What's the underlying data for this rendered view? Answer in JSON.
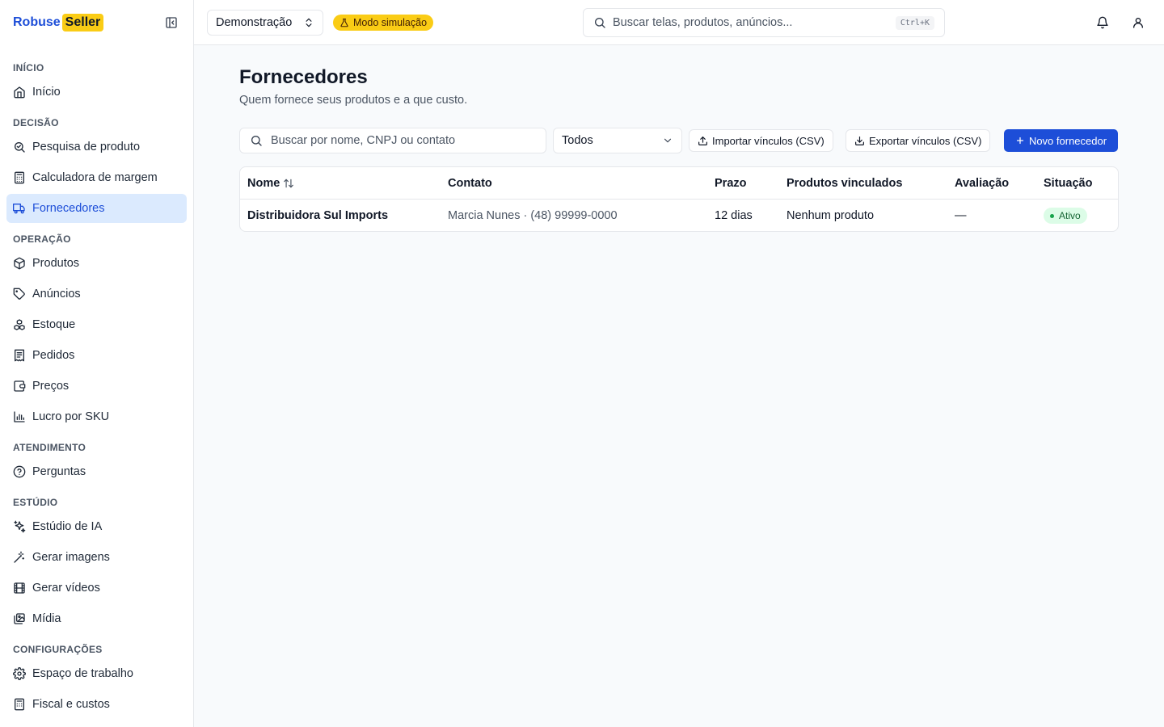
{
  "brand": {
    "word1": "Robuse",
    "word2": "Seller"
  },
  "sidebar": {
    "sections": [
      {
        "label": "INÍCIO",
        "items": [
          {
            "label": "Início",
            "icon": "home-icon"
          }
        ]
      },
      {
        "label": "DECISÃO",
        "items": [
          {
            "label": "Pesquisa de produto",
            "icon": "search-check-icon"
          },
          {
            "label": "Calculadora de margem",
            "icon": "calculator-icon"
          },
          {
            "label": "Fornecedores",
            "icon": "truck-icon",
            "active": true
          }
        ]
      },
      {
        "label": "OPERAÇÃO",
        "items": [
          {
            "label": "Produtos",
            "icon": "package-icon"
          },
          {
            "label": "Anúncios",
            "icon": "tag-icon"
          },
          {
            "label": "Estoque",
            "icon": "boxes-icon"
          },
          {
            "label": "Pedidos",
            "icon": "receipt-icon"
          },
          {
            "label": "Preços",
            "icon": "wallet-icon"
          },
          {
            "label": "Lucro por SKU",
            "icon": "bar-chart-icon"
          }
        ]
      },
      {
        "label": "ATENDIMENTO",
        "items": [
          {
            "label": "Perguntas",
            "icon": "help-circle-icon"
          }
        ]
      },
      {
        "label": "ESTÚDIO",
        "items": [
          {
            "label": "Estúdio de IA",
            "icon": "sparkles-icon"
          },
          {
            "label": "Gerar imagens",
            "icon": "wand-icon"
          },
          {
            "label": "Gerar vídeos",
            "icon": "film-icon"
          },
          {
            "label": "Mídia",
            "icon": "images-icon"
          }
        ]
      },
      {
        "label": "CONFIGURAÇÕES",
        "items": [
          {
            "label": "Espaço de trabalho",
            "icon": "gear-icon"
          },
          {
            "label": "Fiscal e custos",
            "icon": "calculator-icon"
          }
        ]
      }
    ]
  },
  "header": {
    "workspace": "Demonstração",
    "simulation_badge": "Modo simulação",
    "search_placeholder": "Buscar telas, produtos, anúncios...",
    "search_shortcut": "Ctrl+K"
  },
  "page": {
    "title": "Fornecedores",
    "subtitle": "Quem fornece seus produtos e a que custo."
  },
  "toolbar": {
    "search_placeholder": "Buscar por nome, CNPJ ou contato",
    "status_filter": "Todos",
    "import_label": "Importar vínculos (CSV)",
    "export_label": "Exportar vínculos (CSV)",
    "new_label": "Novo fornecedor"
  },
  "table": {
    "headers": {
      "nome": "Nome",
      "contato": "Contato",
      "prazo": "Prazo",
      "produtos": "Produtos vinculados",
      "avaliacao": "Avaliação",
      "situacao": "Situação"
    },
    "rows": [
      {
        "nome": "Distribuidora Sul Imports",
        "contato": "Marcia Nunes · (48) 99999-0000",
        "prazo": "12 dias",
        "produtos": "Nenhum produto",
        "avaliacao": "—",
        "situacao": "Ativo"
      }
    ]
  },
  "colors": {
    "accent": "#1d4ed8",
    "brand_yellow": "#facc15",
    "active_bg": "#dbeafe",
    "status_green": "#16a34a"
  }
}
